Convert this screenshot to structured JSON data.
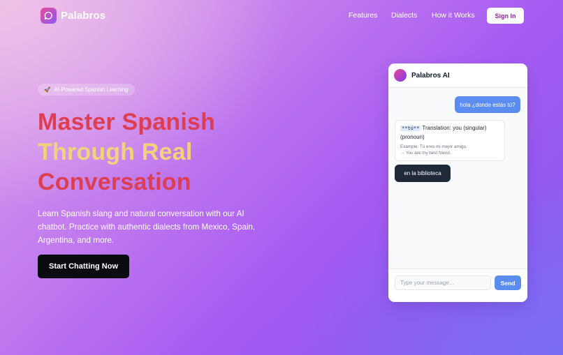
{
  "nav": {
    "brand": "Palabros",
    "links": [
      "Features",
      "Dialects",
      "How it Works"
    ],
    "sign_in": "Sign In"
  },
  "hero": {
    "badge_icon": "rocket-icon",
    "badge": "AI-Powered Spanish Learning",
    "title_lines": [
      "Master Spanish",
      "Through Real",
      "Conversation"
    ],
    "subtitle": "Learn Spanish slang and natural conversation with our AI chatbot. Practice with authentic dialects from Mexico, Spain, Argentina, and more.",
    "cta": "Start Chatting Now"
  },
  "chat": {
    "title": "Palabros AI",
    "messages": {
      "user": "hola ¿donde estás tú?",
      "bot_term": "**tú**",
      "bot_translation": "Translation: you (singular) (pronoun)",
      "bot_example": "Example: Tú eres mi mejor amigo.",
      "bot_example_translation": "→ You are my best friend.",
      "reply": "en la biblioteca"
    },
    "input_placeholder": "Type your message...",
    "send": "Send"
  },
  "colors": {
    "title_red": "#dd3e52",
    "title_gold": "#f1d27c",
    "accent_blue": "#5b8cf0",
    "sign_in_text": "#a21caf"
  }
}
